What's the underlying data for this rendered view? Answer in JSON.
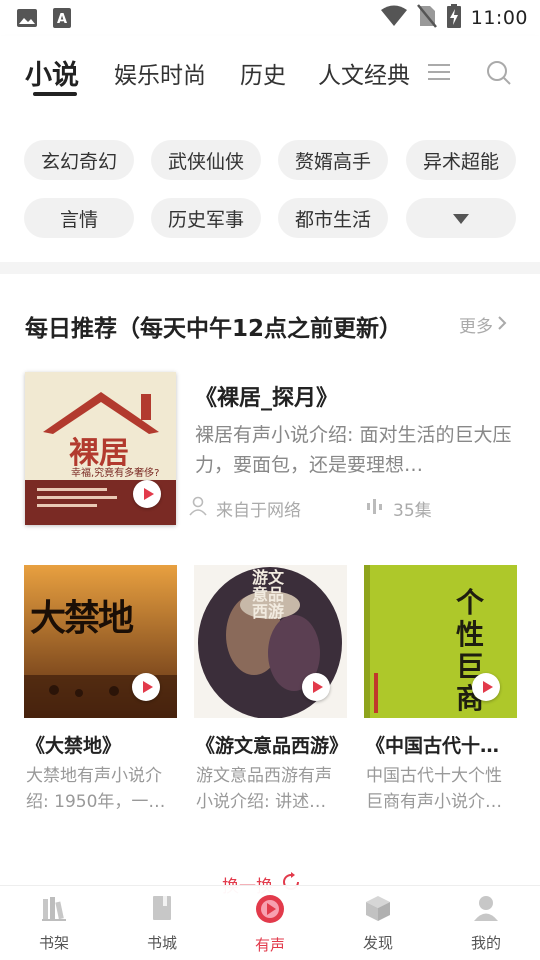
{
  "status_bar": {
    "time": "11:00",
    "icons": [
      "image-icon",
      "text-a-icon",
      "wifi-icon",
      "no-sim-icon",
      "battery-charging-icon"
    ]
  },
  "top_nav": {
    "tabs": [
      {
        "label": "小说",
        "active": true
      },
      {
        "label": "娱乐时尚",
        "active": false
      },
      {
        "label": "历史",
        "active": false
      },
      {
        "label": "人文经典",
        "active": false
      }
    ],
    "icons": [
      "menu-icon",
      "search-icon"
    ]
  },
  "categories": {
    "chips": [
      "玄幻奇幻",
      "武侠仙侠",
      "赘婿高手",
      "异术超能",
      "言情",
      "历史军事",
      "都市生活"
    ],
    "expand_icon": "triangle-down-icon"
  },
  "section": {
    "title": "每日推荐（每天中午12点之前更新）",
    "more_label": "更多"
  },
  "featured": {
    "title": "《裸居_探月》",
    "description": "裸居有声小说介绍: 面对生活的巨大压力，要面包，还是要理想…",
    "source": "来自于网络",
    "episodes": "35集",
    "cover_text": "裸居",
    "cover_subtitle": "幸福,究竟有多奢侈?"
  },
  "books": [
    {
      "title": "《大禁地》",
      "description": "大禁地有声小说介绍: 1950年，一…",
      "cover_text": "大禁地"
    },
    {
      "title": "《游文意品西游》",
      "description": "游文意品西游有声小说介绍: 讲述…",
      "cover_text": "游文意品西游"
    },
    {
      "title": "《中国古代十大个性巨商》",
      "description": "中国古代十大个性巨商有声小说介…",
      "cover_text": "个性巨商"
    }
  ],
  "refresh_label": "换一换",
  "bottom_nav": [
    {
      "label": "书架",
      "icon": "bookshelf-icon",
      "active": false
    },
    {
      "label": "书城",
      "icon": "book-icon",
      "active": false
    },
    {
      "label": "有声",
      "icon": "audio-play-icon",
      "active": true
    },
    {
      "label": "发现",
      "icon": "cube-icon",
      "active": false
    },
    {
      "label": "我的",
      "icon": "user-icon",
      "active": false
    }
  ],
  "colors": {
    "accent": "#e23a4b",
    "chip_bg": "#f1f1f1",
    "text": "#222222",
    "muted": "#999999"
  }
}
